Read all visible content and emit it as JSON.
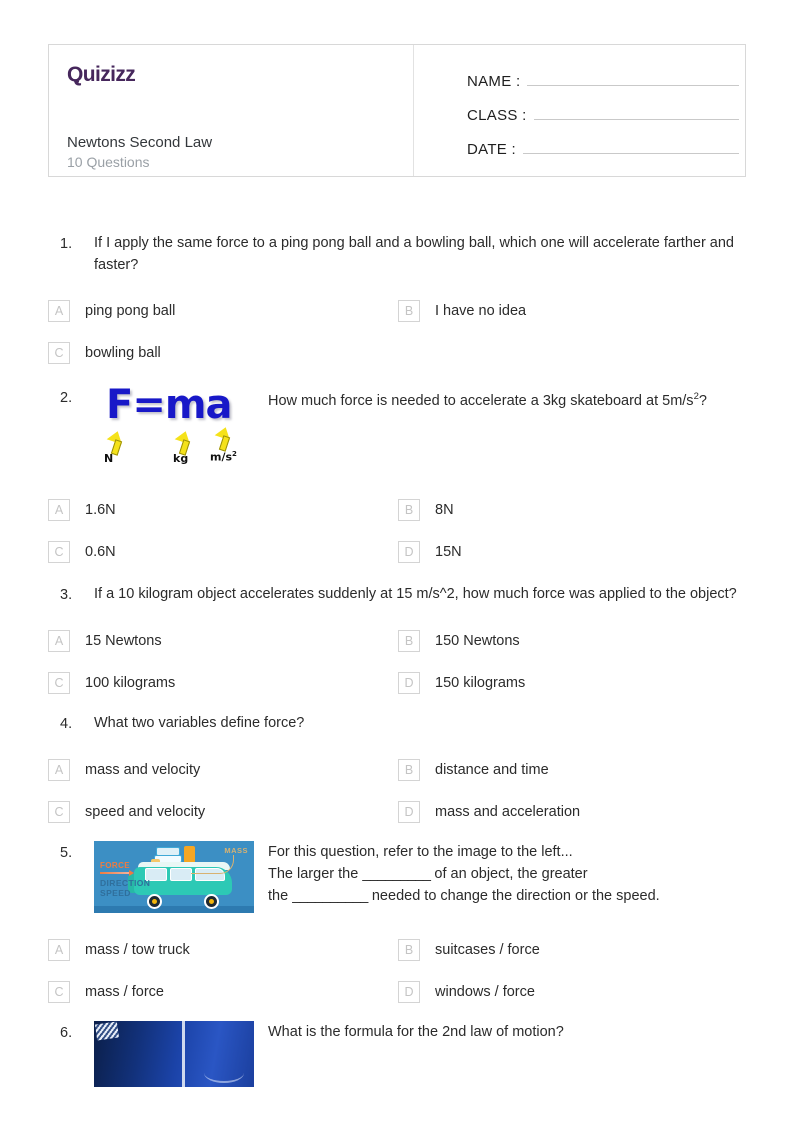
{
  "header": {
    "logo_text": "Quizizz",
    "quiz_title": "Newtons Second Law",
    "question_count_label": "10 Questions",
    "fields": [
      {
        "label": "NAME :"
      },
      {
        "label": "CLASS :"
      },
      {
        "label": "DATE  :"
      }
    ],
    "border_color": "#d8d8d8",
    "logo_color": "#46275c"
  },
  "questions": [
    {
      "number": "1.",
      "text": "If I apply the same force to a ping pong ball and a bowling ball, which one will accelerate farther and faster?",
      "options": [
        {
          "letter": "A",
          "text": "ping pong ball"
        },
        {
          "letter": "B",
          "text": "I have no idea"
        },
        {
          "letter": "C",
          "text": "bowling ball"
        }
      ]
    },
    {
      "number": "2.",
      "text_part1": "How much force is needed to accelerate a 3kg skateboard at 5m/s",
      "text_sup": "2",
      "text_part2": "?",
      "image": {
        "type": "fma-diagram",
        "equation": "F=ma",
        "labels": [
          "N",
          "kg",
          "m/s"
        ],
        "label_sup": "2",
        "equation_color": "#1818c8",
        "arrow_color": "#f5e21a"
      },
      "options": [
        {
          "letter": "A",
          "text": "1.6N"
        },
        {
          "letter": "B",
          "text": "8N"
        },
        {
          "letter": "C",
          "text": "0.6N"
        },
        {
          "letter": "D",
          "text": "15N"
        }
      ]
    },
    {
      "number": "3.",
      "text": "If a 10 kilogram object accelerates suddenly at 15 m/s^2, how much force was applied to the object?",
      "options": [
        {
          "letter": "A",
          "text": "15 Newtons"
        },
        {
          "letter": "B",
          "text": "150 Newtons"
        },
        {
          "letter": "C",
          "text": "100 kilograms"
        },
        {
          "letter": "D",
          "text": "150 kilograms"
        }
      ]
    },
    {
      "number": "4.",
      "text": "What two variables define force?",
      "options": [
        {
          "letter": "A",
          "text": "mass and velocity"
        },
        {
          "letter": "B",
          "text": "distance and time"
        },
        {
          "letter": "C",
          "text": "speed and velocity"
        },
        {
          "letter": "D",
          "text": "mass and acceleration"
        }
      ]
    },
    {
      "number": "5.",
      "line1": "For this question, refer to the image to the left...",
      "line2_a": "The larger the ",
      "line2_blank": "_________",
      "line2_b": " of an object, the greater",
      "line3_a": "the ",
      "line3_blank": "__________",
      "line3_b": " needed to change the direction or the speed.",
      "image": {
        "type": "van-illustration",
        "labels": [
          "MASS",
          "FORCE",
          "DIRECTION",
          "SPEED"
        ],
        "background_color": "#3c8fc4",
        "van_color": "#2dc9b5"
      },
      "options": [
        {
          "letter": "A",
          "text": "mass / tow truck"
        },
        {
          "letter": "B",
          "text": "suitcases / force"
        },
        {
          "letter": "C",
          "text": "mass / force"
        },
        {
          "letter": "D",
          "text": "windows / force"
        }
      ]
    },
    {
      "number": "6.",
      "text": "What is the formula for the 2nd law of motion?",
      "image": {
        "type": "blue-photo"
      }
    }
  ]
}
